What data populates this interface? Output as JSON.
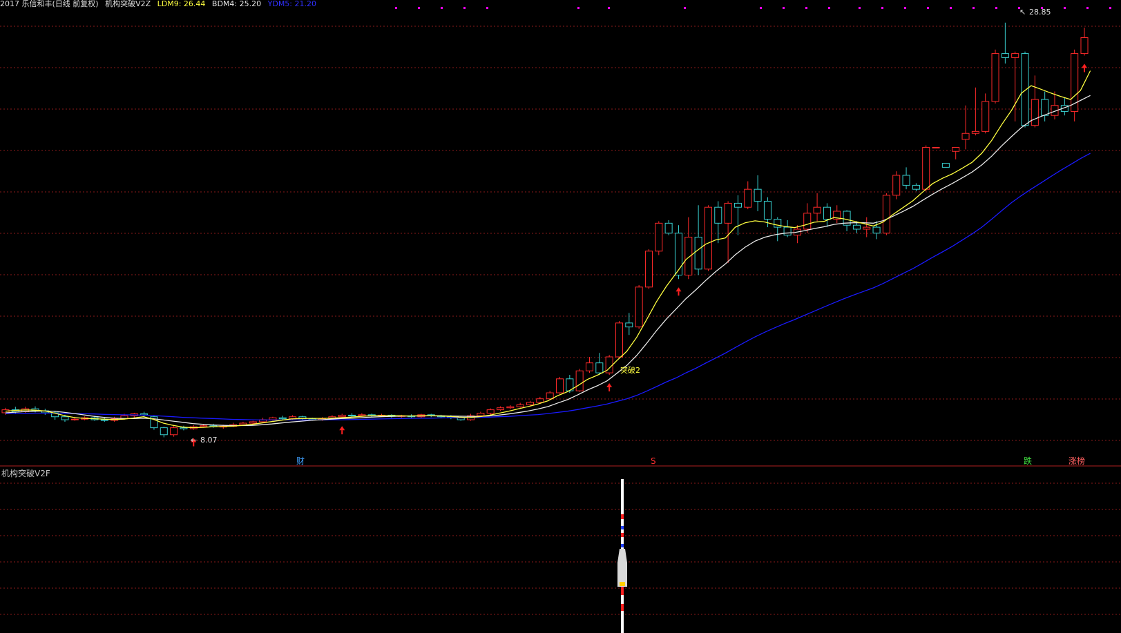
{
  "header": {
    "title": "2017 乐信和丰(日线 前复权)",
    "indicator": "机构突破V2Z",
    "ldm_label": "LDM9: 26.44",
    "bdm_label": "BDM4: 25.20",
    "third_label": "YDM5: 21.20"
  },
  "sub_panel": {
    "title": "机构突破V2F"
  },
  "annotations": {
    "high_label": "28.85",
    "low_label": "8.07",
    "breakout_label": "突破2",
    "marker_cai": "财",
    "marker_s": "S",
    "marker_die": "跌",
    "marker_zhang": "涨榜"
  },
  "colors": {
    "up": "#ff2a2a",
    "down": "#38d0d0",
    "ma_yellow": "#ffff40",
    "ma_white": "#e8e8e8",
    "ma_blue": "#1a1aff",
    "grid": "#8b1a1a",
    "magenta": "#ff00ff",
    "arrow": "#ff2020"
  },
  "chart_data": {
    "type": "candlestick",
    "candles": [
      [
        9.3,
        9.45,
        9.55,
        9.2
      ],
      [
        9.45,
        9.35,
        9.6,
        9.25
      ],
      [
        9.35,
        9.5,
        9.6,
        9.3
      ],
      [
        9.5,
        9.4,
        9.62,
        9.32
      ],
      [
        9.4,
        9.3,
        9.5,
        9.2
      ],
      [
        9.3,
        9.1,
        9.4,
        8.95
      ],
      [
        9.1,
        8.95,
        9.2,
        8.85
      ],
      [
        8.95,
        8.98,
        9.1,
        8.9
      ],
      [
        8.98,
        9.05,
        9.12,
        8.92
      ],
      [
        9.05,
        8.95,
        9.15,
        8.9
      ],
      [
        8.95,
        8.92,
        9.05,
        8.85
      ],
      [
        8.92,
        9.0,
        9.1,
        8.85
      ],
      [
        9.0,
        9.15,
        9.25,
        8.95
      ],
      [
        9.15,
        9.25,
        9.3,
        9.05
      ],
      [
        9.25,
        9.2,
        9.35,
        9.1
      ],
      [
        9.1,
        8.55,
        9.15,
        8.45
      ],
      [
        8.55,
        8.2,
        8.6,
        8.07
      ],
      [
        8.2,
        8.55,
        8.65,
        8.1
      ],
      [
        8.55,
        8.5,
        8.65,
        8.42
      ],
      [
        8.5,
        8.6,
        8.68,
        8.45
      ],
      [
        8.6,
        8.65,
        8.72,
        8.55
      ],
      [
        8.65,
        8.6,
        8.75,
        8.55
      ],
      [
        8.6,
        8.62,
        8.7,
        8.5
      ],
      [
        8.62,
        8.7,
        8.8,
        8.58
      ],
      [
        8.7,
        8.78,
        8.85,
        8.65
      ],
      [
        8.78,
        8.85,
        8.9,
        8.72
      ],
      [
        8.85,
        8.95,
        9.05,
        8.8
      ],
      [
        8.95,
        9.05,
        9.1,
        8.9
      ],
      [
        9.05,
        9.0,
        9.15,
        8.95
      ],
      [
        9.0,
        9.1,
        9.18,
        8.95
      ],
      [
        9.1,
        9.0,
        9.15,
        8.92
      ],
      [
        9.0,
        8.95,
        9.05,
        8.9
      ],
      [
        8.95,
        9.0,
        9.08,
        8.9
      ],
      [
        9.0,
        9.1,
        9.18,
        8.95
      ],
      [
        9.1,
        9.18,
        9.25,
        9.05
      ],
      [
        9.18,
        9.15,
        9.28,
        9.1
      ],
      [
        9.15,
        9.2,
        9.28,
        9.1
      ],
      [
        9.2,
        9.15,
        9.26,
        9.08
      ],
      [
        9.15,
        9.18,
        9.25,
        9.1
      ],
      [
        9.18,
        9.12,
        9.22,
        9.05
      ],
      [
        9.12,
        9.15,
        9.2,
        9.05
      ],
      [
        9.15,
        9.1,
        9.22,
        9.05
      ],
      [
        9.1,
        9.2,
        9.25,
        9.05
      ],
      [
        9.2,
        9.15,
        9.25,
        9.08
      ],
      [
        9.15,
        9.1,
        9.2,
        9.02
      ],
      [
        9.1,
        9.05,
        9.18,
        8.98
      ],
      [
        9.05,
        8.95,
        9.1,
        8.9
      ],
      [
        8.95,
        9.15,
        9.25,
        8.9
      ],
      [
        9.15,
        9.28,
        9.35,
        9.1
      ],
      [
        9.28,
        9.45,
        9.52,
        9.2
      ],
      [
        9.45,
        9.55,
        9.62,
        9.4
      ],
      [
        9.55,
        9.6,
        9.68,
        9.48
      ],
      [
        9.6,
        9.7,
        9.8,
        9.55
      ],
      [
        9.7,
        9.82,
        9.9,
        9.65
      ],
      [
        9.82,
        10.0,
        10.1,
        9.75
      ],
      [
        10.0,
        10.3,
        10.4,
        9.95
      ],
      [
        10.3,
        11.0,
        11.1,
        10.25
      ],
      [
        11.0,
        10.4,
        11.2,
        10.3
      ],
      [
        10.4,
        11.4,
        11.5,
        10.35
      ],
      [
        11.4,
        11.8,
        12.1,
        11.3
      ],
      [
        11.8,
        11.3,
        12.3,
        11.2
      ],
      [
        11.3,
        12.1,
        12.2,
        11.2
      ],
      [
        12.1,
        13.8,
        13.9,
        12.0
      ],
      [
        13.8,
        13.6,
        14.3,
        13.2
      ],
      [
        13.6,
        15.6,
        15.7,
        13.5
      ],
      [
        15.6,
        17.4,
        17.5,
        15.5
      ],
      [
        17.4,
        18.8,
        18.9,
        17.2
      ],
      [
        18.8,
        18.3,
        18.95,
        18.2
      ],
      [
        18.3,
        16.2,
        18.7,
        16.0
      ],
      [
        16.2,
        18.1,
        19.1,
        16.0
      ],
      [
        18.1,
        16.5,
        19.7,
        16.2
      ],
      [
        16.5,
        19.6,
        19.7,
        16.4
      ],
      [
        19.6,
        18.8,
        19.9,
        17.8
      ],
      [
        18.8,
        19.8,
        19.9,
        16.8
      ],
      [
        19.8,
        19.6,
        20.2,
        18.2
      ],
      [
        19.6,
        20.5,
        20.9,
        19.5
      ],
      [
        20.5,
        19.9,
        21.2,
        19.4
      ],
      [
        19.9,
        19.0,
        20.1,
        18.6
      ],
      [
        19.0,
        18.6,
        19.1,
        17.9
      ],
      [
        18.6,
        18.2,
        18.95,
        18.1
      ],
      [
        18.2,
        18.5,
        18.7,
        17.8
      ],
      [
        18.5,
        19.3,
        19.8,
        18.3
      ],
      [
        19.3,
        19.6,
        20.3,
        18.9
      ],
      [
        19.6,
        19.0,
        19.8,
        18.6
      ],
      [
        19.0,
        19.4,
        19.7,
        18.8
      ],
      [
        19.4,
        18.7,
        19.45,
        18.4
      ],
      [
        18.7,
        18.5,
        18.9,
        18.3
      ],
      [
        18.5,
        18.6,
        19.1,
        18.1
      ],
      [
        18.6,
        18.3,
        18.9,
        18.0
      ],
      [
        18.3,
        20.2,
        20.3,
        18.2
      ],
      [
        20.2,
        21.2,
        21.4,
        20.0
      ],
      [
        21.2,
        20.7,
        21.6,
        20.5
      ],
      [
        20.7,
        20.5,
        20.8,
        20.4
      ],
      [
        20.5,
        22.6,
        22.7,
        20.4
      ],
      [
        22.6,
        22.6,
        22.6,
        22.6
      ],
      [
        21.8,
        21.6,
        21.7,
        21.6
      ],
      [
        22.4,
        22.6,
        22.6,
        22.0
      ],
      [
        23.0,
        23.3,
        24.7,
        22.5
      ],
      [
        23.3,
        23.4,
        25.6,
        23.2
      ],
      [
        23.4,
        24.9,
        25.3,
        23.3
      ],
      [
        24.9,
        27.3,
        27.5,
        24.8
      ],
      [
        27.3,
        27.1,
        28.85,
        26.8
      ],
      [
        27.1,
        27.3,
        27.4,
        23.9
      ],
      [
        27.3,
        23.7,
        27.4,
        23.6
      ],
      [
        23.7,
        25.0,
        26.2,
        23.6
      ],
      [
        25.0,
        24.2,
        25.4,
        23.9
      ],
      [
        24.2,
        24.7,
        25.4,
        24.0
      ],
      [
        24.7,
        24.4,
        25.1,
        24.2
      ],
      [
        24.4,
        27.3,
        27.5,
        23.9
      ],
      [
        27.3,
        28.1,
        28.6,
        27.2
      ]
    ],
    "ma_yellow": [
      9.38,
      9.42,
      9.44,
      9.43,
      9.39,
      9.28,
      9.15,
      9.06,
      9.02,
      9.0,
      8.98,
      8.96,
      8.98,
      9.04,
      9.1,
      8.97,
      8.78,
      8.67,
      8.58,
      8.55,
      8.57,
      8.6,
      8.61,
      8.63,
      8.67,
      8.72,
      8.79,
      8.86,
      8.93,
      8.99,
      9.01,
      9.02,
      9.02,
      9.03,
      9.05,
      9.08,
      9.12,
      9.15,
      9.16,
      9.15,
      9.15,
      9.14,
      9.15,
      9.15,
      9.14,
      9.12,
      9.08,
      9.06,
      9.1,
      9.17,
      9.27,
      9.38,
      9.5,
      9.61,
      9.74,
      9.9,
      10.16,
      10.36,
      10.65,
      10.97,
      11.18,
      11.43,
      11.92,
      12.38,
      13.08,
      13.96,
      14.86,
      15.63,
      16.29,
      16.98,
      17.38,
      17.75,
      17.96,
      18.06,
      18.6,
      18.82,
      18.92,
      18.86,
      18.73,
      18.64,
      18.58,
      18.7,
      18.85,
      18.89,
      19.08,
      19.02,
      18.9,
      18.78,
      18.66,
      18.86,
      19.24,
      19.58,
      19.92,
      20.36,
      20.78,
      21.05,
      21.27,
      21.55,
      21.85,
      22.31,
      22.95,
      23.73,
      24.45,
      25.31,
      25.69,
      25.51,
      25.32,
      25.15,
      25.0,
      25.45,
      26.44
    ],
    "ma_white": [
      9.3,
      9.33,
      9.36,
      9.38,
      9.39,
      9.37,
      9.32,
      9.26,
      9.19,
      9.12,
      9.07,
      9.03,
      9.01,
      9.01,
      9.03,
      9.0,
      8.94,
      8.88,
      8.82,
      8.76,
      8.72,
      8.69,
      8.67,
      8.66,
      8.66,
      8.67,
      8.7,
      8.74,
      8.79,
      8.84,
      8.88,
      8.92,
      8.95,
      8.98,
      9.01,
      9.03,
      9.05,
      9.08,
      9.1,
      9.12,
      9.13,
      9.14,
      9.14,
      9.15,
      9.15,
      9.14,
      9.13,
      9.12,
      9.12,
      9.14,
      9.18,
      9.24,
      9.31,
      9.39,
      9.49,
      9.61,
      9.79,
      9.96,
      10.19,
      10.44,
      10.65,
      10.9,
      11.28,
      11.67,
      12.17,
      12.77,
      13.41,
      13.99,
      14.5,
      15.02,
      15.46,
      15.93,
      16.37,
      16.76,
      17.22,
      17.6,
      17.9,
      18.1,
      18.22,
      18.3,
      18.33,
      18.42,
      18.53,
      18.62,
      18.74,
      18.8,
      18.82,
      18.82,
      18.8,
      18.93,
      19.15,
      19.39,
      19.64,
      19.95,
      20.25,
      20.53,
      20.79,
      21.07,
      21.36,
      21.72,
      22.16,
      22.67,
      23.14,
      23.59,
      23.94,
      24.15,
      24.34,
      24.52,
      24.7,
      24.95,
      25.2
    ],
    "ma_blue": [
      9.25,
      9.26,
      9.27,
      9.28,
      9.28,
      9.28,
      9.27,
      9.26,
      9.25,
      9.24,
      9.22,
      9.21,
      9.2,
      9.19,
      9.18,
      9.16,
      9.13,
      9.1,
      9.07,
      9.05,
      9.03,
      9.01,
      8.99,
      8.97,
      8.96,
      8.95,
      8.94,
      8.94,
      8.94,
      8.94,
      8.94,
      8.94,
      8.94,
      8.95,
      8.95,
      8.96,
      8.97,
      8.98,
      8.99,
      9.0,
      9.01,
      9.02,
      9.03,
      9.03,
      9.04,
      9.05,
      9.05,
      9.06,
      9.07,
      9.08,
      9.1,
      9.12,
      9.15,
      9.18,
      9.21,
      9.26,
      9.32,
      9.38,
      9.46,
      9.55,
      9.64,
      9.74,
      9.87,
      10.0,
      10.17,
      10.38,
      10.61,
      10.84,
      11.05,
      11.3,
      11.53,
      11.79,
      12.04,
      12.29,
      12.57,
      12.84,
      13.1,
      13.34,
      13.56,
      13.77,
      13.97,
      14.18,
      14.39,
      14.6,
      14.81,
      15.01,
      15.2,
      15.38,
      15.56,
      15.78,
      16.03,
      16.28,
      16.52,
      16.8,
      17.09,
      17.36,
      17.64,
      17.95,
      18.26,
      18.6,
      19.0,
      19.42,
      19.83,
      20.18,
      20.51,
      20.82,
      21.14,
      21.45,
      21.74,
      22.04,
      22.3
    ],
    "arrow_up_indices": [
      20,
      37,
      66,
      73,
      121,
      129
    ],
    "y_range": [
      7.5,
      29.5
    ],
    "grid": true
  }
}
